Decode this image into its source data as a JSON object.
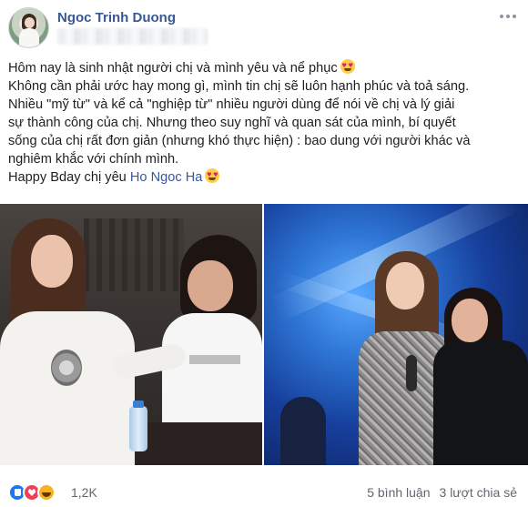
{
  "post": {
    "author": "Ngoc Trinh Duong",
    "content": {
      "line1": "Hôm nay là sinh nhật người chị và mình yêu và nể phục",
      "line2": "Không cần phải ước hay mong gì, mình tin chị sẽ luôn hạnh phúc và toả sáng.",
      "line3": "Nhiều \"mỹ từ\" và kể cả \"nghiệp từ\" nhiều người dùng để nói về chị và lý giải",
      "line4": "sự thành công của chị. Nhưng theo suy nghĩ và quan sát của mình, bí quyết",
      "line5": "sống của chị rất đơn giản (nhưng khó thực hiện) : bao dung với người khác và",
      "line6": "nghiêm khắc với chính mình.",
      "line7_prefix": "Happy Bday chị yêu",
      "mention": "Ho Ngoc Ha"
    },
    "photos": {
      "left_icon": "photo-left",
      "right_icon": "photo-right"
    },
    "footer": {
      "reaction_icons": [
        "like-icon",
        "love-icon",
        "haha-icon"
      ],
      "reaction_count": "1,2K",
      "comments": "5 bình luận",
      "shares": "3 lượt chia sẻ"
    },
    "colors": {
      "author_link": "#385898",
      "text": "#1c1e21",
      "muted": "#606770"
    }
  }
}
